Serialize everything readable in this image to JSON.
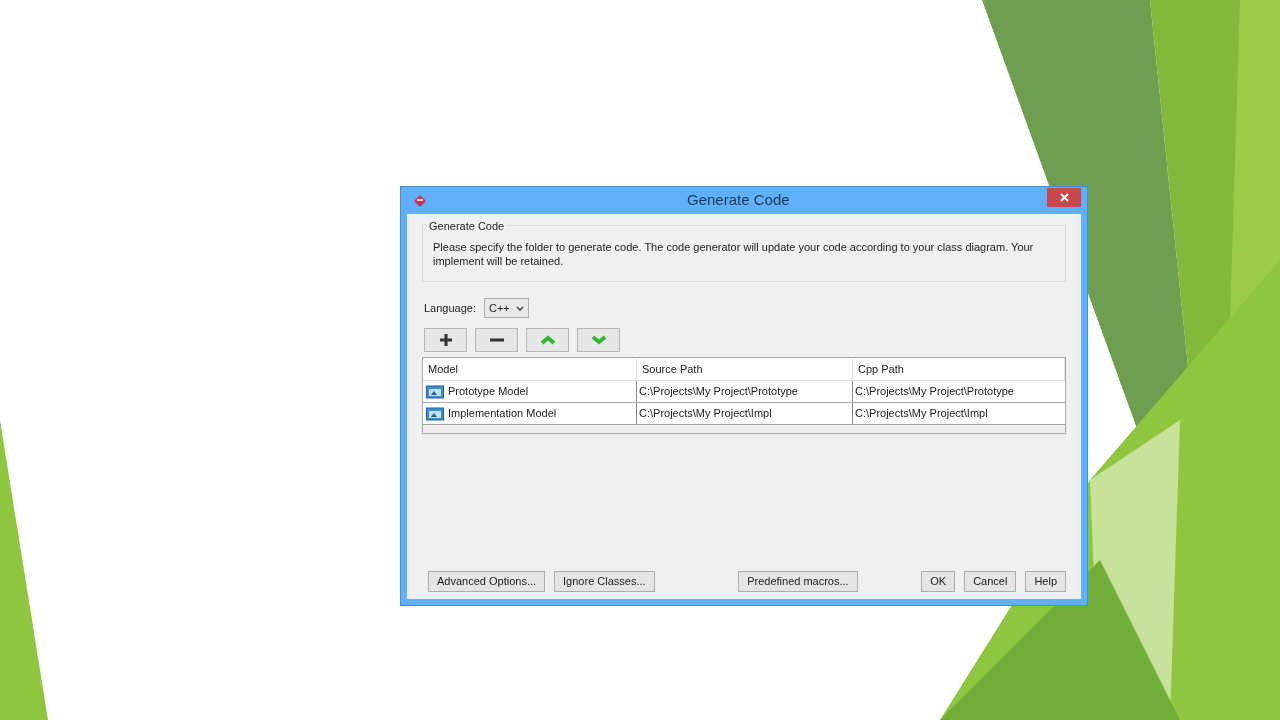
{
  "window": {
    "title": "Generate Code"
  },
  "group": {
    "title": "Generate Code",
    "description": "Please specify the folder to generate code. The code generator will update your code according to your class diagram. Your implement will be retained."
  },
  "language": {
    "label": "Language:",
    "value": "C++"
  },
  "toolbar": [
    {
      "kind": "add"
    },
    {
      "kind": "remove"
    },
    {
      "kind": "up"
    },
    {
      "kind": "down"
    }
  ],
  "table": {
    "columns": [
      "Model",
      "Source Path",
      "Cpp Path"
    ],
    "rows": [
      {
        "model": "Prototype Model",
        "source_path": "C:\\Projects\\My Project\\Prototype",
        "cpp_path": "C:\\Projects\\My Project\\Prototype"
      },
      {
        "model": "Implementation Model",
        "source_path": "C:\\Projects\\My Project\\Impl",
        "cpp_path": "C:\\Projects\\My Project\\Impl"
      }
    ]
  },
  "left_buttons": [
    "Advanced Options...",
    "Ignore Classes..."
  ],
  "center_buttons": [
    "Predefined macros..."
  ],
  "right_buttons": [
    "OK",
    "Cancel",
    "Help"
  ]
}
